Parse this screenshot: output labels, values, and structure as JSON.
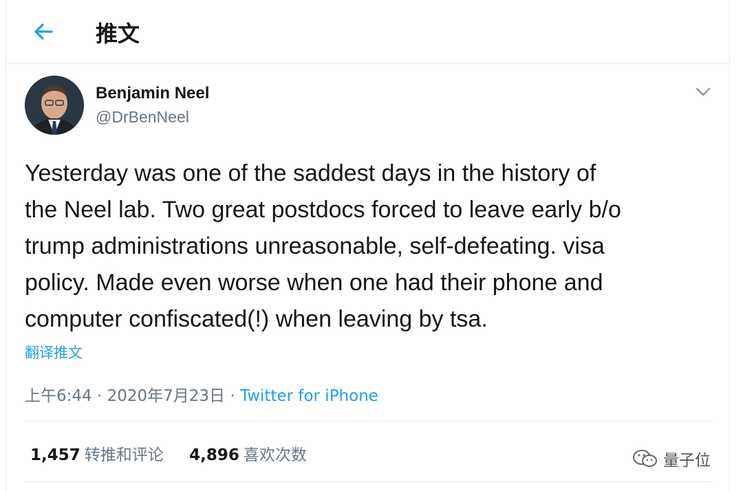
{
  "header": {
    "title": "推文",
    "back_icon": "arrow-left-icon"
  },
  "author": {
    "name": "Benjamin Neel",
    "handle": "@DrBenNeel"
  },
  "tweet": {
    "lines": [
      "Yesterday was one of the saddest days in the history of",
      "the Neel lab. Two great postdocs forced to leave early b/o",
      "trump administrations unreasonable, self-defeating. visa",
      "policy. Made even worse when one had their phone and",
      "computer confiscated(!) when leaving by tsa."
    ],
    "translate_label": "翻译推文"
  },
  "meta": {
    "time": "上午6:44",
    "date": "2020年7月23日",
    "separator": "·",
    "source": "Twitter for iPhone"
  },
  "stats": {
    "retweets_count": "1,457",
    "retweets_label": "转推和评论",
    "likes_count": "4,896",
    "likes_label": "喜欢次数"
  },
  "watermark": {
    "text": "量子位"
  },
  "colors": {
    "accent": "#1da1f2",
    "secondary_text": "#657786",
    "divider": "#e6ecf0"
  }
}
